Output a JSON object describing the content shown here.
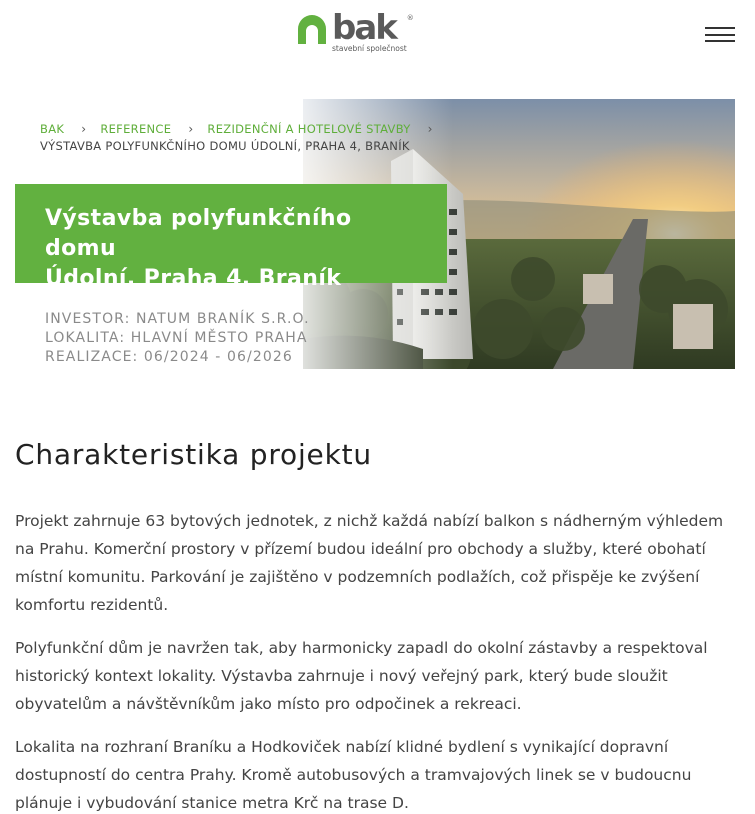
{
  "header": {
    "logo_word": "bak",
    "logo_reg": "®",
    "logo_sub": "stavební společnost",
    "brand_color": "#62b140"
  },
  "breadcrumb": {
    "items": [
      "BAK",
      "REFERENCE",
      "REZIDENČNÍ A HOTELOVÉ STAVBY"
    ],
    "separator": "›",
    "current": "VÝSTAVBA POLYFUNKČNÍHO DOMU ÚDOLNÍ, PRAHA 4, BRANÍK"
  },
  "hero": {
    "title_line1": "Výstavba polyfunkčního domu",
    "title_line2": "Údolní, Praha 4, Braník"
  },
  "meta": {
    "investor": "INVESTOR: NATUM BRANÍK S.R.O.",
    "lokalita": "LOKALITA: HLAVNÍ MĚSTO PRAHA",
    "realizace": "REALIZACE: 06/2024 - 06/2026"
  },
  "content": {
    "section_title": "Charakteristika projektu",
    "paragraphs": [
      "Projekt zahrnuje 63 bytových jednotek, z nichž každá nabízí balkon s nádherným výhledem na Prahu. Komerční prostory v přízemí budou ideální pro obchody a služby, které obohatí místní komunitu. Parkování je zajištěno v podzemních podlažích, což přispěje ke zvýšení komfortu rezidentů.",
      "Polyfunkční dům je navržen tak, aby harmonicky zapadl do okolní zástavby a respektoval historický kontext lokality. Výstavba zahrnuje i nový veřejný park, který bude sloužit obyvatelům a návštěvníkům jako místo pro odpočinek a rekreaci.",
      "Lokalita na rozhraní Braníku a Hodkoviček nabízí klidné bydlení s vynikající dopravní dostupností do centra Prahy. Kromě autobusových a tramvajových linek se v budoucnu plánuje i vybudování stanice metra Krč na trase D."
    ]
  },
  "icons": {
    "logo": "house-arch-logo-icon",
    "menu": "hamburger-menu-icon",
    "chevron": "chevron-right-icon"
  }
}
